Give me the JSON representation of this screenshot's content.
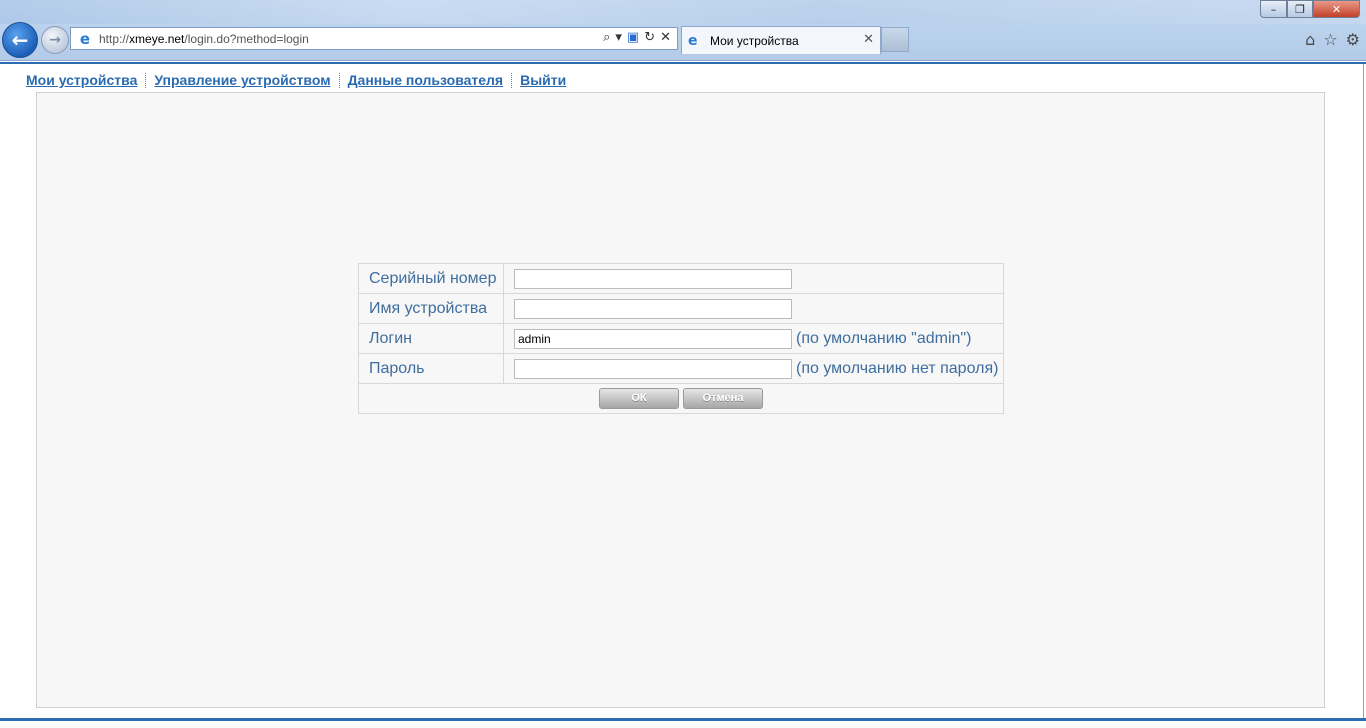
{
  "browser": {
    "url_prefix": "http://",
    "url_host": "xmeye.net",
    "url_path": "/login.do?method=login",
    "tab_title": "Мои устройства",
    "tools": {
      "search": "⌕",
      "dropdown": "▾",
      "compat": "▣",
      "refresh": "↻",
      "stop": "✕"
    },
    "window": {
      "minimize": "–",
      "maximize": "❐",
      "close": "✕"
    },
    "right_tools": {
      "home": "⌂",
      "favorites": "☆",
      "settings": "⚙"
    }
  },
  "nav": {
    "items": [
      {
        "label": "Мои устройства"
      },
      {
        "label": "Управление устройством"
      },
      {
        "label": "Данные пользователя"
      },
      {
        "label": "Выйти"
      }
    ]
  },
  "form": {
    "serial_label": "Серийный номер",
    "serial_value": "",
    "device_name_label": "Имя устройства",
    "device_name_value": "",
    "login_label": "Логин",
    "login_value": "admin",
    "login_hint": "(по умолчанию \"admin\")",
    "password_label": "Пароль",
    "password_value": "",
    "password_hint": "(по умолчанию нет пароля)",
    "ok_label": "ОК",
    "cancel_label": "Отмена"
  },
  "colors": {
    "link": "#2a6bb0",
    "label": "#3f6e9e",
    "panel_bg": "#f7f7f7",
    "rule": "#2b6cb3"
  }
}
